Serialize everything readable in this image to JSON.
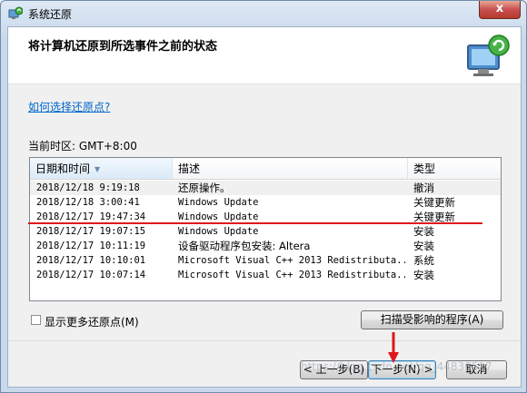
{
  "window": {
    "title": "系统还原",
    "close_label": "x"
  },
  "header": {
    "title": "将计算机还原到所选事件之前的状态"
  },
  "help_link": "如何选择还原点?",
  "timezone": "当前时区: GMT+8:00",
  "table": {
    "columns": [
      "日期和时间",
      "描述",
      "类型"
    ],
    "rows": [
      {
        "date": "2018/12/18 9:19:18",
        "desc": "还原操作。",
        "type": "撤消"
      },
      {
        "date": "2018/12/18 3:00:41",
        "desc": "Windows Update",
        "type": "关键更新"
      },
      {
        "date": "2018/12/17 19:47:34",
        "desc": "Windows Update",
        "type": "关键更新"
      },
      {
        "date": "2018/12/17 19:07:15",
        "desc": "Windows Update",
        "type": "安装"
      },
      {
        "date": "2018/12/17 10:11:19",
        "desc": "设备驱动程序包安装: Altera",
        "type": "安装"
      },
      {
        "date": "2018/12/17 10:10:01",
        "desc": "Microsoft Visual C++ 2013 Redistributa...",
        "type": "系统"
      },
      {
        "date": "2018/12/17 10:07:14",
        "desc": "Microsoft Visual C++ 2013 Redistributa...",
        "type": "安装"
      }
    ]
  },
  "options": {
    "show_more_label": "显示更多还原点(M)"
  },
  "buttons": {
    "scan": "扫描受影响的程序(A)",
    "back": "< 上一步(B)",
    "next": "下一步(N) >",
    "cancel": "取消"
  },
  "watermark": "https://blog.csdn.net/qq_44836517",
  "colors": {
    "annotation_red": "#e0161c",
    "link_blue": "#0066cc"
  }
}
